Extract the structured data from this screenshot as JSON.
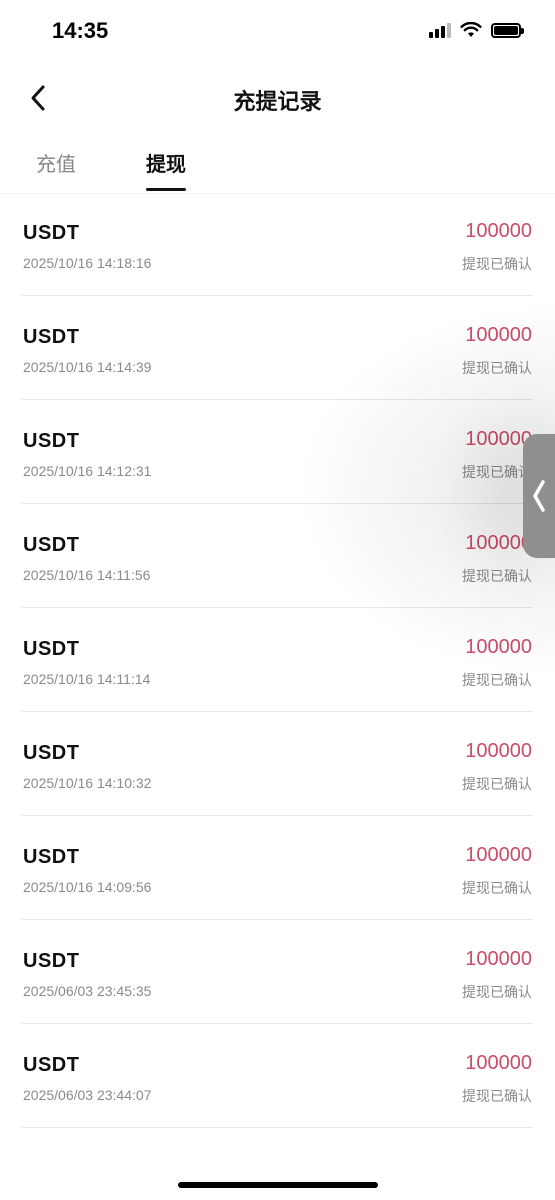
{
  "status_bar": {
    "time": "14:35"
  },
  "header": {
    "title": "充提记录"
  },
  "tabs": [
    {
      "label": "充值",
      "active": false
    },
    {
      "label": "提现",
      "active": true
    }
  ],
  "records": [
    {
      "currency": "USDT",
      "time": "2025/10/16 14:18:16",
      "amount": "100000",
      "status": "提现已确认"
    },
    {
      "currency": "USDT",
      "time": "2025/10/16 14:14:39",
      "amount": "100000",
      "status": "提现已确认"
    },
    {
      "currency": "USDT",
      "time": "2025/10/16 14:12:31",
      "amount": "100000",
      "status": "提现已确认"
    },
    {
      "currency": "USDT",
      "time": "2025/10/16 14:11:56",
      "amount": "100000",
      "status": "提现已确认"
    },
    {
      "currency": "USDT",
      "time": "2025/10/16 14:11:14",
      "amount": "100000",
      "status": "提现已确认"
    },
    {
      "currency": "USDT",
      "time": "2025/10/16 14:10:32",
      "amount": "100000",
      "status": "提现已确认"
    },
    {
      "currency": "USDT",
      "time": "2025/10/16 14:09:56",
      "amount": "100000",
      "status": "提现已确认"
    },
    {
      "currency": "USDT",
      "time": "2025/06/03 23:45:35",
      "amount": "100000",
      "status": "提现已确认"
    },
    {
      "currency": "USDT",
      "time": "2025/06/03 23:44:07",
      "amount": "100000",
      "status": "提现已确认"
    }
  ],
  "colors": {
    "amount": "#c94c68",
    "muted": "#8a8a8a",
    "text": "#111111"
  },
  "icons": {
    "back": "chevron-left-icon",
    "side_handle": "chevron-left-icon"
  }
}
